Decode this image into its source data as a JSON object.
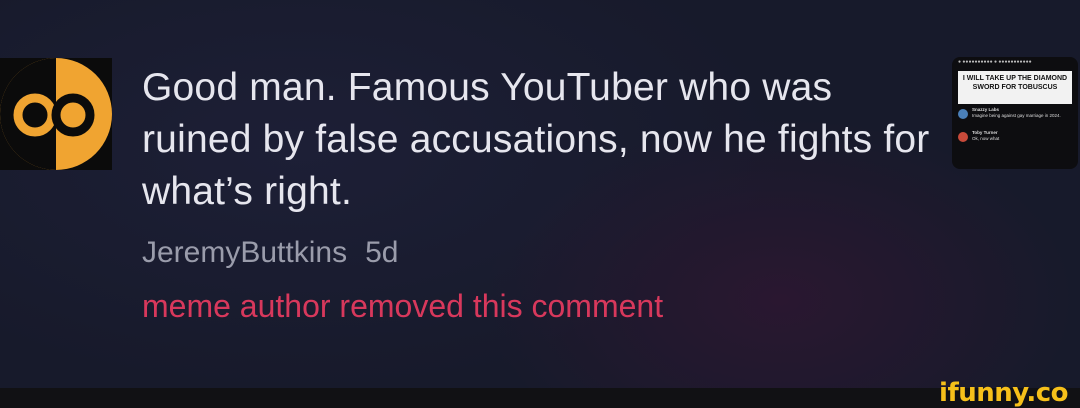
{
  "comment": {
    "text": "Good man. Famous YouTuber who was ruined by false accusations, now he fights for what’s right.",
    "author": "JeremyButtkins",
    "time": "5d",
    "removed_notice": "meme author removed this comment"
  },
  "thumbnail": {
    "banner": "I WILL TAKE UP THE DIAMOND SWORD FOR TOBUSCUS",
    "tweet1_name": "Snazzy Labs",
    "tweet1_text": "Imagine being against gay marriage in 2024.",
    "tweet2_name": "Toby Turner",
    "tweet2_text": "Ok, now what"
  },
  "footer": {
    "brand": "ifunny.co"
  },
  "colors": {
    "background": "#171a2b",
    "accent_removed": "#d8385c",
    "brand": "#f6c01a",
    "avatar_orange": "#f0a431"
  }
}
